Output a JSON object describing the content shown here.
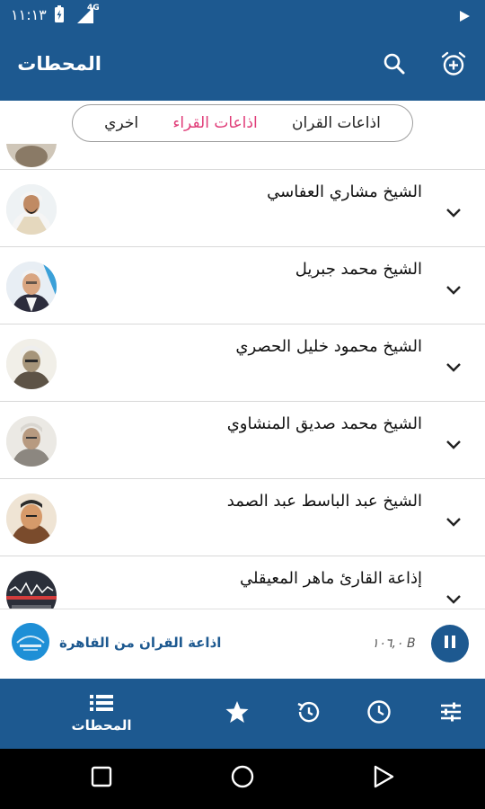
{
  "status": {
    "time": "١١:١٣",
    "network": "4G"
  },
  "appbar": {
    "title": "المحطات",
    "search_icon": "search-icon",
    "alarm_icon": "alarm-add-icon"
  },
  "filters": {
    "items": [
      "اخري",
      "اذاعات القراء",
      "اذاعات القران"
    ],
    "active": "اذاعات القراء"
  },
  "stations": [
    {
      "name": "الشيخ مشاري العفاسي"
    },
    {
      "name": "الشيخ محمد جبريل"
    },
    {
      "name": "الشيخ محمود خليل الحصري"
    },
    {
      "name": "الشيخ محمد صديق المنشاوي"
    },
    {
      "name": "الشيخ عبد الباسط عبد الصمد"
    },
    {
      "name": "إذاعة القارئ ماهر المعيقلي"
    }
  ],
  "player": {
    "title": "اذاعة القران من القاهرة",
    "frequency": "١٠٦,٠ B",
    "state": "playing"
  },
  "bottom_nav": {
    "stations_label": "المحطات",
    "active": "stations"
  },
  "colors": {
    "primary": "#1d5990",
    "accent": "#e03c78"
  }
}
